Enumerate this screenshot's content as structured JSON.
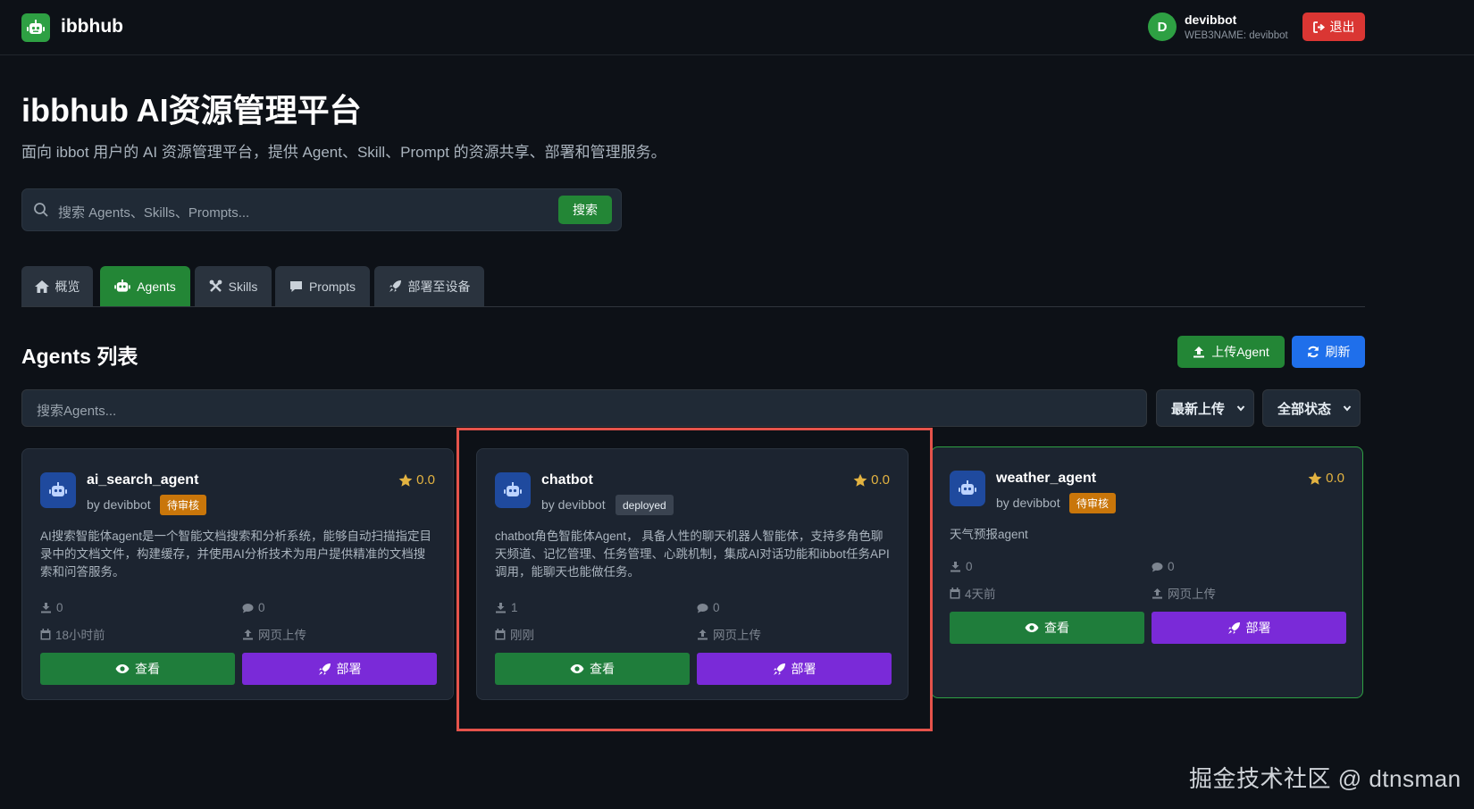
{
  "header": {
    "brand": "ibbhub",
    "user": {
      "avatar_letter": "D",
      "name": "devibbot",
      "web3name": "WEB3NAME: devibbot"
    },
    "logout_label": "退出"
  },
  "hero": {
    "title": "ibbhub AI资源管理平台",
    "subtitle": "面向 ibbot 用户的 AI 资源管理平台，提供 Agent、Skill、Prompt 的资源共享、部署和管理服务。",
    "search_placeholder": "搜索 Agents、Skills、Prompts...",
    "search_button": "搜索"
  },
  "tabs": [
    {
      "label": "概览",
      "icon": "home-icon",
      "active": false
    },
    {
      "label": "Agents",
      "icon": "robot-icon",
      "active": true
    },
    {
      "label": "Skills",
      "icon": "tools-icon",
      "active": false
    },
    {
      "label": "Prompts",
      "icon": "comment-icon",
      "active": false
    },
    {
      "label": "部署至设备",
      "icon": "rocket-icon",
      "active": false
    }
  ],
  "section": {
    "title": "Agents 列表",
    "upload_label": "上传Agent",
    "refresh_label": "刷新",
    "filter_placeholder": "搜索Agents...",
    "sort_selected": "最新上传",
    "status_selected": "全部状态"
  },
  "agents": [
    {
      "name": "ai_search_agent",
      "by": "by devibbot",
      "status": "待审核",
      "rating": "0.0",
      "description": "AI搜索智能体agent是一个智能文档搜索和分析系统，能够自动扫描指定目录中的文档文件，构建缓存，并使用AI分析技术为用户提供精准的文档搜索和问答服务。",
      "downloads": "0",
      "comments": "0",
      "time": "18小时前",
      "source": "网页上传",
      "view_label": "查看",
      "deploy_label": "部署"
    },
    {
      "name": "chatbot",
      "by": "by devibbot",
      "status": "deployed",
      "rating": "0.0",
      "description": "chatbot角色智能体Agent， 具备人性的聊天机器人智能体，支持多角色聊天频道、记忆管理、任务管理、心跳机制，集成AI对话功能和ibbot任务API调用，能聊天也能做任务。",
      "downloads": "1",
      "comments": "0",
      "time": "刚刚",
      "source": "网页上传",
      "view_label": "查看",
      "deploy_label": "部署"
    },
    {
      "name": "weather_agent",
      "by": "by devibbot",
      "status": "待审核",
      "rating": "0.0",
      "description": "天气预报agent",
      "downloads": "0",
      "comments": "0",
      "time": "4天前",
      "source": "网页上传",
      "view_label": "查看",
      "deploy_label": "部署"
    }
  ],
  "watermark": "掘金技术社区 @ dtnsman",
  "colors": {
    "background": "#0d1117",
    "primary_green": "#238636",
    "blue": "#1f6feb",
    "purple": "#7a2ad8",
    "danger": "#da3633",
    "pending_badge": "#c9760a",
    "star": "#e3b341"
  }
}
